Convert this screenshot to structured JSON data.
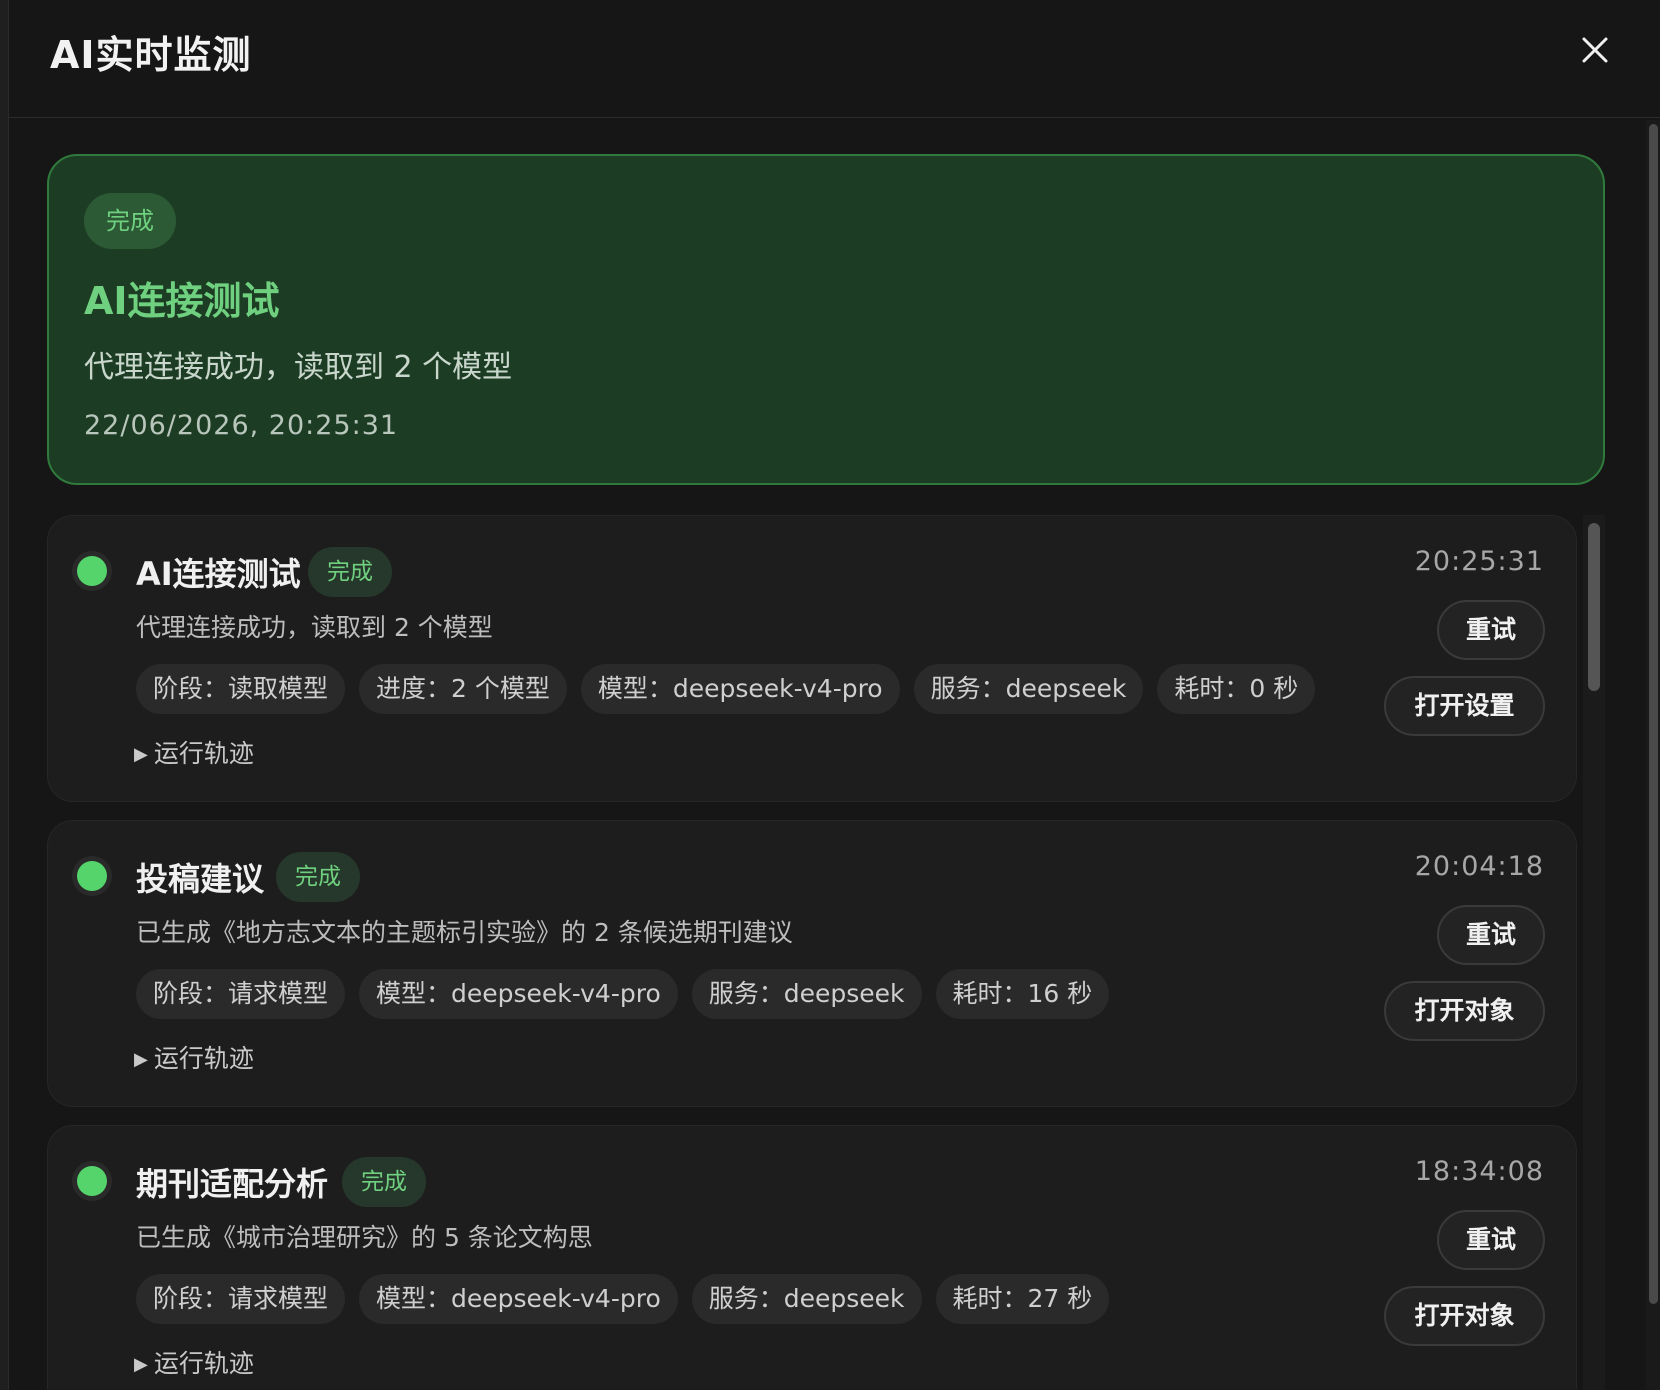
{
  "dialog": {
    "title": "AI实时监测",
    "close_icon": "close-icon"
  },
  "summary": {
    "badge": "完成",
    "title": "AI连接测试",
    "description": "代理连接成功，读取到 2 个模型",
    "timestamp": "22/06/2026, 20:25:31",
    "colors": {
      "background": "#1c3d24",
      "border": "#2f7a3c",
      "accent": "#6fd17f"
    }
  },
  "tasks": [
    {
      "title": "AI连接测试",
      "badge": "完成",
      "description": "代理连接成功，读取到 2 个模型",
      "chips": [
        "阶段：读取模型",
        "进度：2 个模型",
        "模型：deepseek-v4-pro",
        "服务：deepseek",
        "耗时：0 秒"
      ],
      "trace_label": "运行轨迹",
      "time": "20:25:31",
      "retry_label": "重试",
      "open_label": "打开设置"
    },
    {
      "title": "投稿建议",
      "badge": "完成",
      "description": "已生成《地方志文本的主题标引实验》的 2 条候选期刊建议",
      "chips": [
        "阶段：请求模型",
        "模型：deepseek-v4-pro",
        "服务：deepseek",
        "耗时：16 秒"
      ],
      "trace_label": "运行轨迹",
      "time": "20:04:18",
      "retry_label": "重试",
      "open_label": "打开对象"
    },
    {
      "title": "期刊适配分析",
      "badge": "完成",
      "description": "已生成《城市治理研究》的 5 条论文构思",
      "chips": [
        "阶段：请求模型",
        "模型：deepseek-v4-pro",
        "服务：deepseek",
        "耗时：27 秒"
      ],
      "trace_label": "运行轨迹",
      "time": "18:34:08",
      "retry_label": "重试",
      "open_label": "打开对象"
    }
  ],
  "status_color": "#55d46c"
}
